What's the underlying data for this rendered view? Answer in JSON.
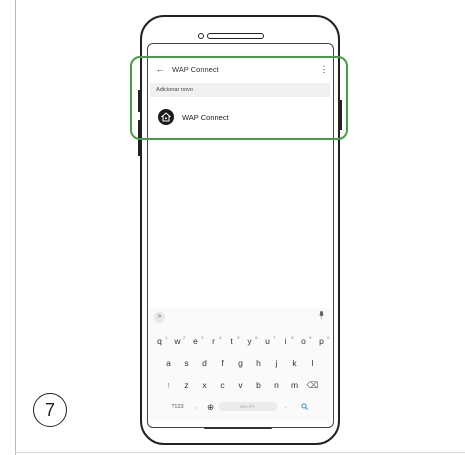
{
  "appbar": {
    "back_icon": "arrow-left-icon",
    "title": "WAP Connect",
    "menu_icon": "more-vertical-icon"
  },
  "section": {
    "header": "Adicionar novo"
  },
  "list": {
    "items": [
      {
        "label": "WAP Connect",
        "icon": "home-app-icon"
      }
    ]
  },
  "keyboard": {
    "row1": [
      {
        "k": "q",
        "n": "1"
      },
      {
        "k": "w",
        "n": "2"
      },
      {
        "k": "e",
        "n": "3"
      },
      {
        "k": "r",
        "n": "4"
      },
      {
        "k": "t",
        "n": "5"
      },
      {
        "k": "y",
        "n": "6"
      },
      {
        "k": "u",
        "n": "7"
      },
      {
        "k": "i",
        "n": "8"
      },
      {
        "k": "o",
        "n": "9"
      },
      {
        "k": "p",
        "n": "0"
      }
    ],
    "row2": [
      "a",
      "s",
      "d",
      "f",
      "g",
      "h",
      "j",
      "k",
      "l"
    ],
    "row3": [
      "↑",
      "z",
      "x",
      "c",
      "v",
      "b",
      "n",
      "m",
      "⌫"
    ],
    "row4": {
      "sym": "?123",
      "comma": ",",
      "globe": "⊕",
      "space": "EN • PT",
      "period": ".",
      "action": "Q"
    },
    "toggle": ">",
    "mic": "🎙"
  },
  "step": {
    "number": "7"
  },
  "colors": {
    "highlight": "#43a047",
    "action": "#1e88e5"
  }
}
